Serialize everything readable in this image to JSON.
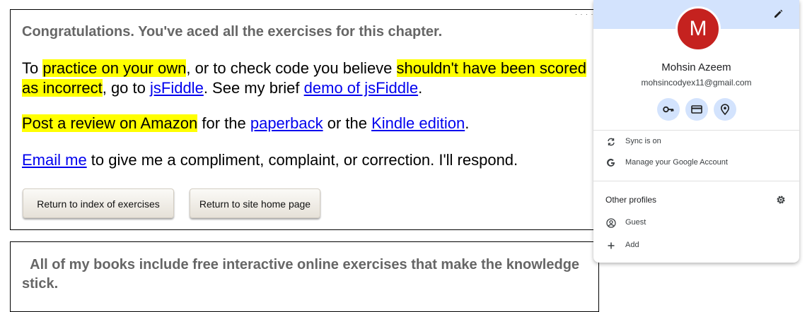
{
  "page": {
    "congrats_heading": "Congratulations. You've aced all the exercises for this chapter.",
    "p1": {
      "t1": "To ",
      "hl1": "practice on your own",
      "t2": ", or to check code you believe ",
      "hl2": "shouldn't have been scored as incorrect",
      "t3": ", go to ",
      "link1": "jsFiddle",
      "t4": ". See my brief ",
      "link2": "demo of jsFiddle",
      "t5": "."
    },
    "p2": {
      "hl": "Post a review on Amazon",
      "t1": " for the ",
      "link1": "paperback",
      "t2": " or the ",
      "link2": "Kindle edition",
      "t3": "."
    },
    "p3": {
      "link": "Email me",
      "t1": " to give me a compliment, complaint, or correction. I'll respond."
    },
    "buttons": {
      "index": "Return to index of exercises",
      "home": "Return to site home page"
    },
    "books_heading": "All of my books include free interactive online exercises that make the knowledge stick."
  },
  "profile": {
    "avatar_letter": "M",
    "name": "Mohsin Azeem",
    "email": "mohsincodyex11@gmail.com",
    "sync": "Sync is on",
    "manage": "Manage your Google Account",
    "other_profiles": "Other profiles",
    "guest": "Guest",
    "add": "Add",
    "quick_icons": [
      "key-icon",
      "card-icon",
      "location-icon"
    ]
  },
  "colors": {
    "highlight": "#ffff00",
    "link": "#0000ee",
    "avatar_bg": "#c5221f",
    "popup_header": "#d3e3fd"
  }
}
